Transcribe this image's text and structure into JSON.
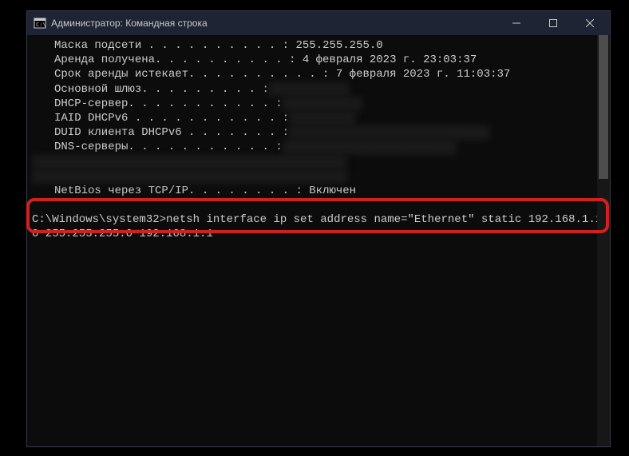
{
  "window": {
    "title": "Администратор: Командная строка"
  },
  "output": {
    "lines": [
      {
        "label": "Маска подсети . . . . . . . . . . :",
        "value": " 255.255.255.0",
        "blurred": false
      },
      {
        "label": "Аренда получена. . . . . . . . . . :",
        "value": " 4 февраля 2023 г. 23:03:37",
        "blurred": false
      },
      {
        "label": "Срок аренды истекает. . . . . . . . . . :",
        "value": " 7 февраля 2023 г. 11:03:37",
        "blurred": false
      },
      {
        "label": "Основной шлюз. . . . . . . . . :",
        "value": " 192.168.0.1",
        "blurred": true
      },
      {
        "label": "DHCP-сервер. . . . . . . . . . . :",
        "value": " 192.168.0.1",
        "blurred": true
      },
      {
        "label": "IAID DHCPv6 . . . . . . . . . . . :",
        "value": " 123456789",
        "blurred": true
      },
      {
        "label": "DUID клиента DHCPv6 . . . . . . . :",
        "value": " 00-01-00-01-00-00-00-00-00-00",
        "blurred": true
      },
      {
        "label": "DNS-серверы. . . . . . . . . . . :",
        "value": " fe80::0000:0000:0000:0000",
        "blurred": true
      },
      {
        "label": "",
        "value": "                                    192.168.0.1",
        "blurred": true
      },
      {
        "label": "",
        "value": "                                    192.168.0.1",
        "blurred": true
      },
      {
        "label": "NetBios через TCP/IP. . . . . . . . :",
        "value": " Включен",
        "blurred": false
      }
    ]
  },
  "prompt": {
    "path": "C:\\Windows\\system32>",
    "command": "netsh interface ip set address name=\"Ethernet\" static 192.168.1.10 255.255.255.0 192.168.1.1"
  }
}
